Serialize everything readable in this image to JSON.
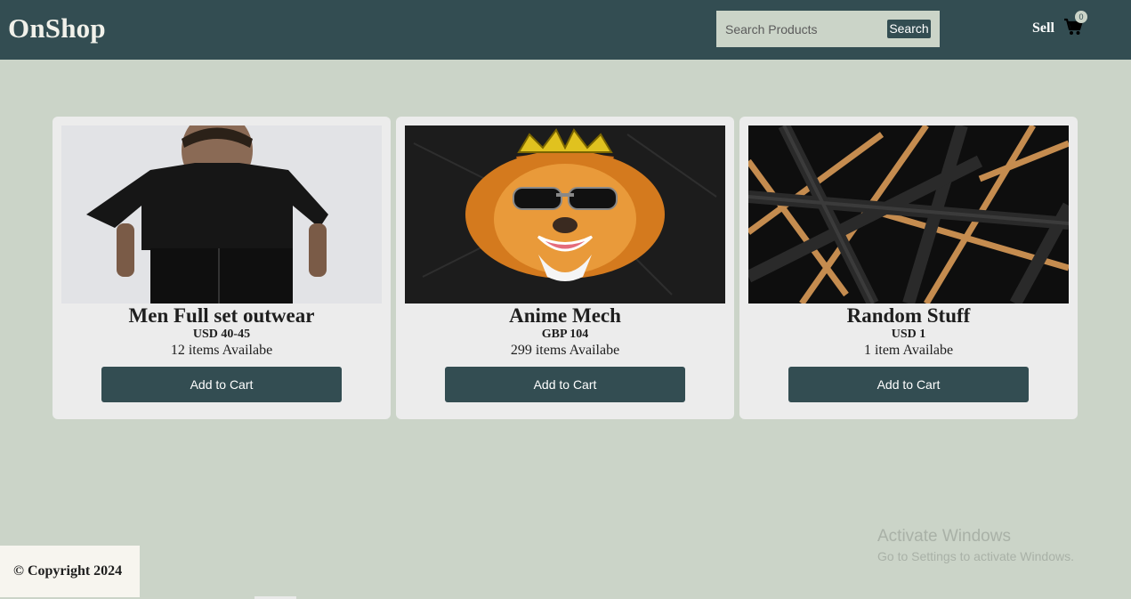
{
  "header": {
    "brand": "OnShop",
    "search_placeholder": "Search Products",
    "search_button": "Search",
    "sell_label": "Sell",
    "cart_icon": "cart-icon",
    "cart_count": "0"
  },
  "products": [
    {
      "title": "Men Full set outwear",
      "price": "USD 40-45",
      "stock": "12 items Availabe",
      "button": "Add to Cart",
      "image": "man-in-black-outfit-photo"
    },
    {
      "title": "Anime Mech",
      "price": "GBP 104",
      "stock": "299 items Availabe",
      "button": "Add to Cart",
      "image": "crowned-lion-with-sunglasses-art"
    },
    {
      "title": "Random Stuff",
      "price": "USD 1",
      "stock": "1 item Availabe",
      "button": "Add to Cart",
      "image": "abstract-black-and-gold-lines"
    }
  ],
  "footer": {
    "copyright": "© Copyright 2024"
  },
  "windows_watermark": {
    "title": "Activate Windows",
    "subtitle": "Go to Settings to activate Windows."
  },
  "colors": {
    "header_bg": "#334d52",
    "page_bg": "#cbd4c8",
    "card_bg": "#ececec",
    "button_bg": "#334d52"
  }
}
